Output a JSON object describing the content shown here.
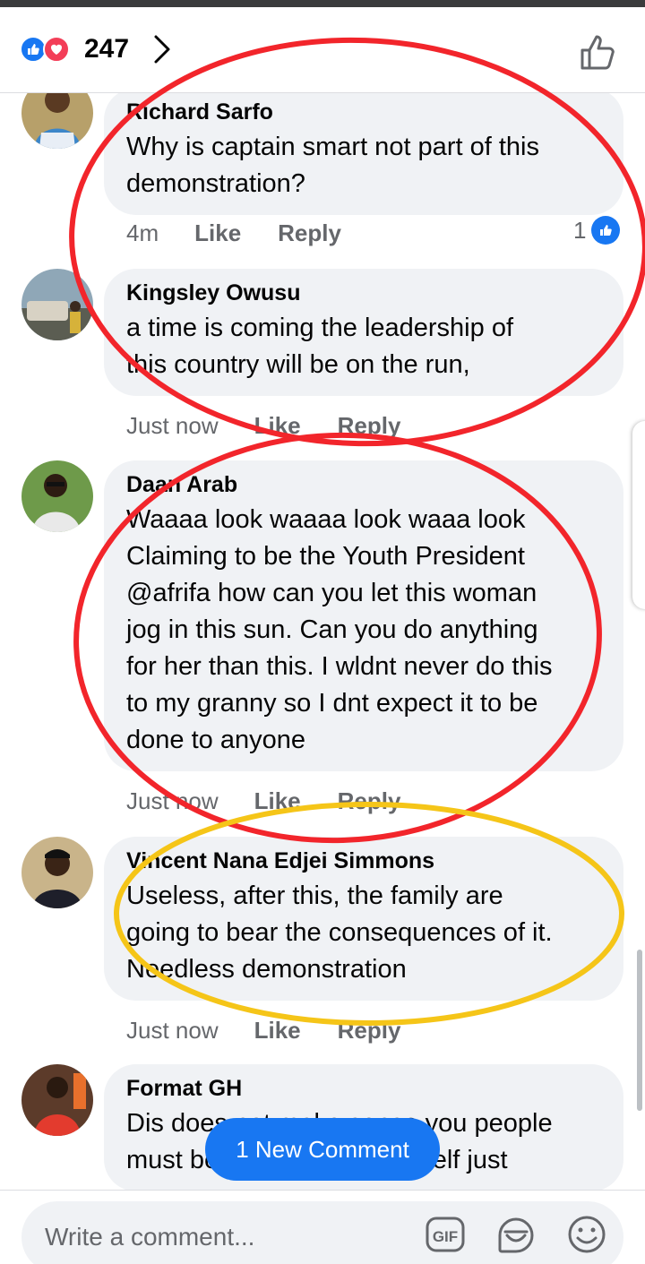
{
  "header": {
    "reaction_count": "247"
  },
  "comments": [
    {
      "author": "Richard Sarfo",
      "lines": [
        "Why is captain smart not part of this",
        "demonstration?"
      ],
      "time": "4m",
      "like_label": "Like",
      "reply_label": "Reply",
      "reactions": "1"
    },
    {
      "author": "Kingsley Owusu",
      "lines": [
        "a time is coming the leadership of",
        "this  country will be on the run,"
      ],
      "time": "Just now",
      "like_label": "Like",
      "reply_label": "Reply"
    },
    {
      "author": "Daan Arab",
      "lines": [
        "Waaaa look waaaa look waaa look",
        "Claiming to be the Youth President",
        "@afrifa how can you let this woman",
        "jog in this sun. Can you do anything",
        "for her than this. I wldnt never do this",
        "to my granny so I dnt expect it to be",
        "done to anyone"
      ],
      "time": "Just now",
      "like_label": "Like",
      "reply_label": "Reply"
    },
    {
      "author": "Vincent Nana Edjei Simmons",
      "lines": [
        "Useless, after this, the family are",
        "going to bear the consequences of it.",
        "Needless demonstration"
      ],
      "time": "Just now",
      "like_label": "Like",
      "reply_label": "Reply"
    },
    {
      "author": "Format GH",
      "lines": [
        "Dis does not make sense you people",
        "must be ashamed of yourself just"
      ]
    }
  ],
  "new_comment_button": "1 New Comment",
  "composer": {
    "placeholder": "Write a comment..."
  },
  "icons": {
    "reaction_like": "thumbs-up-icon",
    "reaction_love": "heart-icon",
    "header_like": "thumbs-up-outline-icon",
    "gif": "gif-icon",
    "sticker": "sticker-icon",
    "emoji": "smiley-icon"
  },
  "colors": {
    "accent": "#1877f2",
    "love": "#f33e58",
    "bubble": "#f0f2f5",
    "annotation_red": "#f2252b",
    "annotation_yellow": "#f5c518"
  }
}
